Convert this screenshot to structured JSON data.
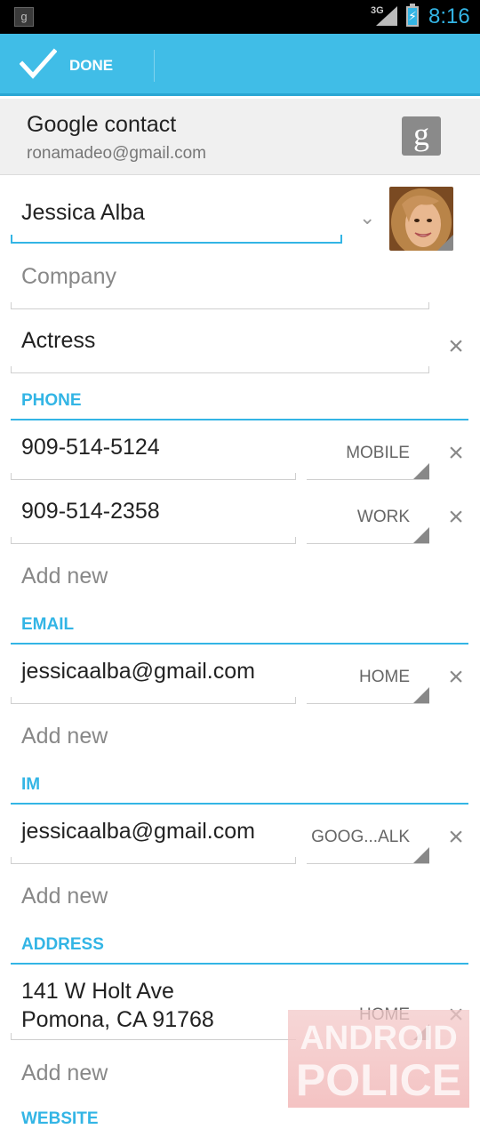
{
  "status_bar": {
    "network": "3G",
    "time": "8:16"
  },
  "action_bar": {
    "done_label": "DONE"
  },
  "account": {
    "type": "Google contact",
    "email": "ronamadeo@gmail.com",
    "badge_letter": "g"
  },
  "name": {
    "value": "Jessica Alba"
  },
  "company": {
    "placeholder": "Company"
  },
  "title": {
    "value": "Actress"
  },
  "sections": {
    "phone": "PHONE",
    "email": "EMAIL",
    "im": "IM",
    "address": "ADDRESS",
    "website": "WEBSITE"
  },
  "phones": [
    {
      "value": "909-514-5124",
      "type": "MOBILE"
    },
    {
      "value": "909-514-2358",
      "type": "WORK"
    }
  ],
  "emails": [
    {
      "value": "jessicaalba@gmail.com",
      "type": "HOME"
    }
  ],
  "ims": [
    {
      "value": "jessicaalba@gmail.com",
      "type": "GOOG...ALK"
    }
  ],
  "addresses": [
    {
      "line1": "141 W Holt Ave",
      "line2": "Pomona, CA 91768",
      "type": "HOME"
    }
  ],
  "add_new_label": "Add new",
  "watermark": {
    "line1": "ANDROID",
    "line2": "POLICE"
  },
  "colors": {
    "accent": "#33b5e5",
    "action_bar": "#40bde7"
  }
}
